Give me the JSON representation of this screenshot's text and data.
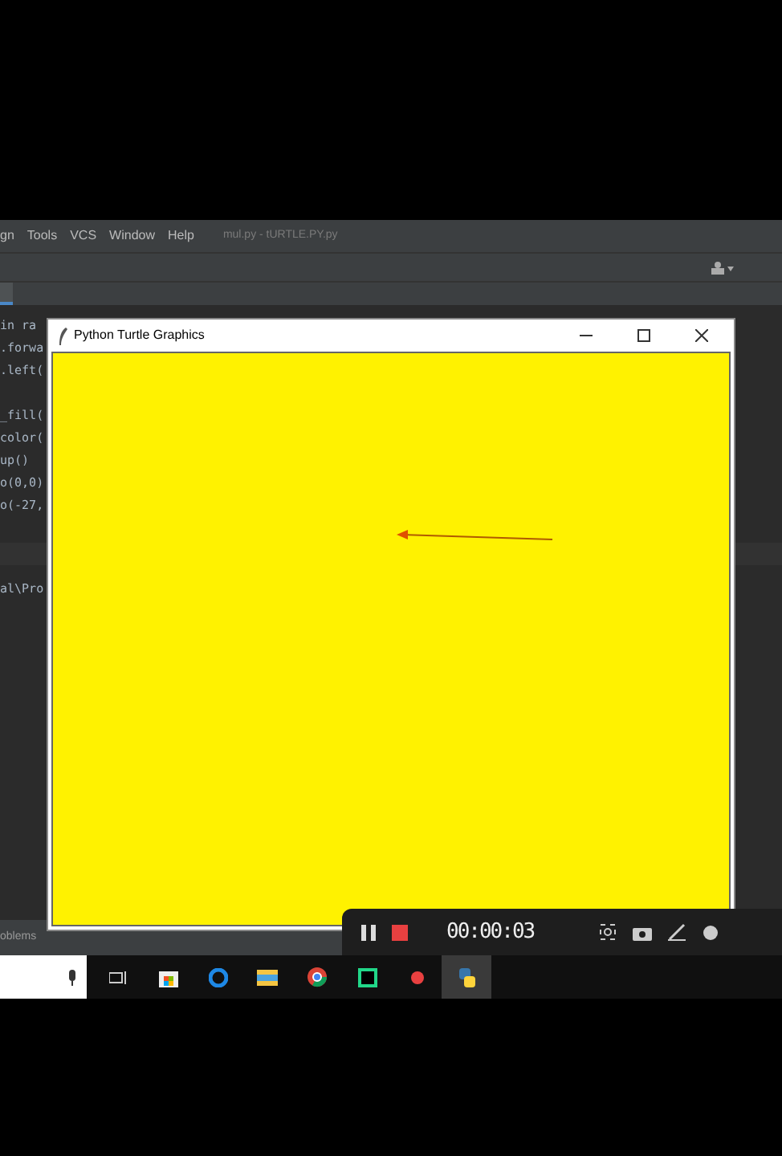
{
  "ide": {
    "menu": [
      "gn",
      "Tools",
      "VCS",
      "Window",
      "Help"
    ],
    "file_title": "mul.py - tURTLE.PY.py",
    "code_blocks": [
      [
        "in ra",
        ".forwa",
        ".left("
      ],
      [
        "_fill(",
        "color(",
        "up()",
        "o(0,0)",
        "o(-27,"
      ]
    ],
    "run_output": "al\\Pro",
    "bottom_tab": "oblems"
  },
  "turtle_window": {
    "title": "Python Turtle Graphics"
  },
  "recorder": {
    "timer": "00:00:03"
  }
}
